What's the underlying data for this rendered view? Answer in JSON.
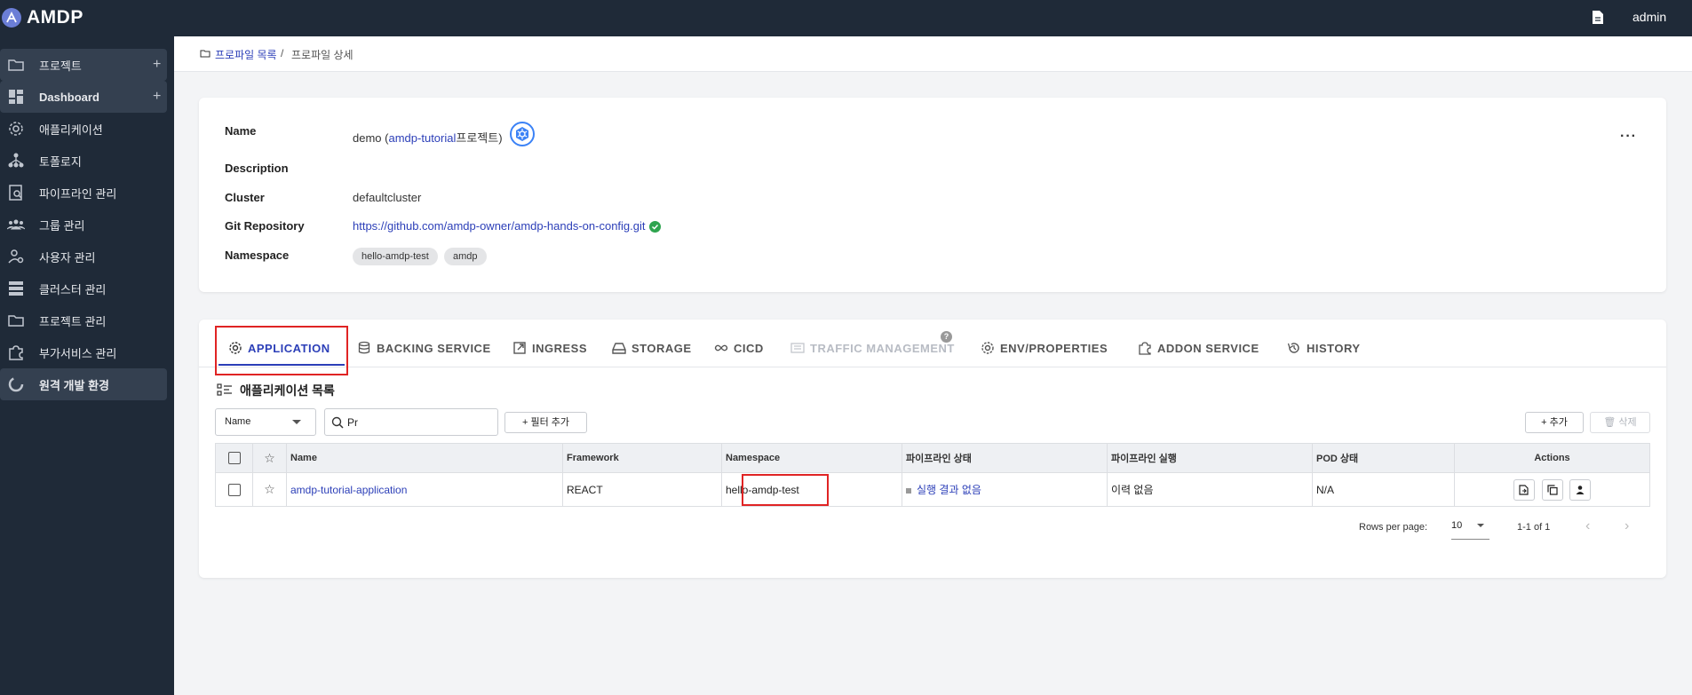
{
  "app": {
    "name": "AMDP"
  },
  "topbar": {
    "user": "admin",
    "doc_icon": "document-icon"
  },
  "sidebar": {
    "items": [
      {
        "label": "프로젝트",
        "icon": "folder-icon",
        "has_add": true,
        "plus": "+"
      },
      {
        "label": "Dashboard",
        "icon": "dashboard-icon",
        "has_add": true,
        "plus": "+"
      },
      {
        "label": "애플리케이션",
        "icon": "gear-icon"
      },
      {
        "label": "토폴로지",
        "icon": "topology-icon"
      },
      {
        "label": "파이프라인 관리",
        "icon": "pipeline-icon"
      },
      {
        "label": "그룹 관리",
        "icon": "group-icon"
      },
      {
        "label": "사용자 관리",
        "icon": "user-settings-icon"
      },
      {
        "label": "클러스터 관리",
        "icon": "cluster-icon"
      },
      {
        "label": "프로젝트 관리",
        "icon": "folder-icon"
      },
      {
        "label": "부가서비스 관리",
        "icon": "puzzle-icon"
      },
      {
        "label": "원격 개발 환경",
        "icon": "remote-dev-icon"
      }
    ]
  },
  "breadcrumb": {
    "parent": "프로파일 목록",
    "separator": "/",
    "current": "프로파일 상세"
  },
  "profile": {
    "labels": {
      "name": "Name",
      "description": "Description",
      "cluster": "Cluster",
      "git": "Git Repository",
      "namespace": "Namespace"
    },
    "name_value": "demo",
    "paren_open": "(",
    "project_link": "amdp-tutorial",
    "project_suffix": "프로젝트)",
    "description_value": "",
    "cluster_value": "defaultcluster",
    "git_value": "https://github.com/amdp-owner/amdp-hands-on-config.git",
    "namespaces": [
      "hello-amdp-test",
      "amdp"
    ],
    "more_label": "···"
  },
  "tabs": [
    {
      "label": "APPLICATION",
      "icon": "gear-icon",
      "state": "active"
    },
    {
      "label": "BACKING SERVICE",
      "icon": "database-icon",
      "state": "normal"
    },
    {
      "label": "INGRESS",
      "icon": "external-link-icon",
      "state": "normal"
    },
    {
      "label": "STORAGE",
      "icon": "storage-icon",
      "state": "normal"
    },
    {
      "label": "CICD",
      "icon": "infinity-icon",
      "state": "normal"
    },
    {
      "label": "TRAFFIC MANAGEMENT",
      "icon": "traffic-icon",
      "state": "disabled"
    },
    {
      "label": "ENV/PROPERTIES",
      "icon": "gear-icon",
      "state": "normal"
    },
    {
      "label": "ADDON SERVICE",
      "icon": "puzzle-icon",
      "state": "normal"
    },
    {
      "label": "HISTORY",
      "icon": "history-icon",
      "state": "normal"
    }
  ],
  "help_badge": "?",
  "app_list": {
    "title": "애플리케이션 목록",
    "filter_field": "Name",
    "search_value": "Pr",
    "add_filter": "+ 필터 추가",
    "add": "+ 추가",
    "delete": "🗑 삭제",
    "columns": [
      "Name",
      "Framework",
      "Namespace",
      "파이프라인 상태",
      "파이프라인 실행",
      "POD 상태",
      "Actions"
    ],
    "rows": [
      {
        "name": "amdp-tutorial-application",
        "framework": "REACT",
        "namespace": "hello-amdp-test",
        "pipeline_status": "실행 결과 없음",
        "pipeline_run": "이력 없음",
        "pod_status": "N/A"
      }
    ],
    "rows_per_page_label": "Rows per page:",
    "rows_per_page": "10",
    "range": "1-1 of 1",
    "prev": "‹",
    "next": "›"
  },
  "colors": {
    "accent": "#2c3fb8",
    "sidebar": "#1f2a38",
    "highlight": "#e02424",
    "success": "#2ea44f"
  }
}
